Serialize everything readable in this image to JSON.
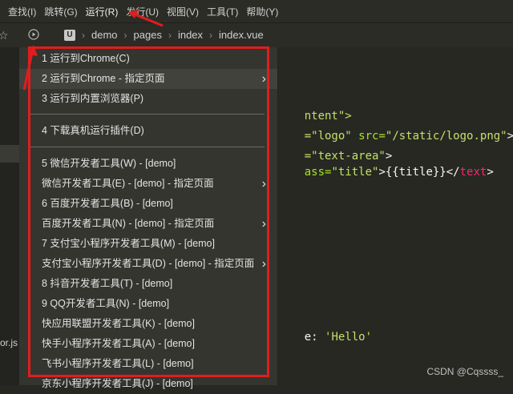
{
  "menubar": {
    "items": [
      "查找(I)",
      "跳转(G)",
      "运行(R)",
      "发行(U)",
      "视图(V)",
      "工具(T)",
      "帮助(Y)"
    ]
  },
  "toolbar": {
    "breadcrumb": [
      "demo",
      "pages",
      "index",
      "index.vue"
    ],
    "u_label": "U"
  },
  "sidebar": {
    "file_label": "or.js"
  },
  "run_menu": {
    "items": [
      {
        "label": "1 运行到Chrome(C)",
        "has_submenu": false
      },
      {
        "label": "2 运行到Chrome - 指定页面",
        "has_submenu": true
      },
      {
        "label": "3 运行到内置浏览器(P)",
        "has_submenu": false
      },
      {
        "label": "4 下载真机运行插件(D)",
        "has_submenu": false
      },
      {
        "label": "5 微信开发者工具(W) - [demo]",
        "has_submenu": false
      },
      {
        "label": "微信开发者工具(E) - [demo] - 指定页面",
        "has_submenu": true
      },
      {
        "label": "6 百度开发者工具(B) - [demo]",
        "has_submenu": false
      },
      {
        "label": "百度开发者工具(N) - [demo] - 指定页面",
        "has_submenu": true
      },
      {
        "label": "7 支付宝小程序开发者工具(M) - [demo]",
        "has_submenu": false
      },
      {
        "label": "支付宝小程序开发者工具(D) - [demo] - 指定页面",
        "has_submenu": true
      },
      {
        "label": "8 抖音开发者工具(T) - [demo]",
        "has_submenu": false
      },
      {
        "label": "9 QQ开发者工具(N) - [demo]",
        "has_submenu": false
      },
      {
        "label": "快应用联盟开发者工具(K) - [demo]",
        "has_submenu": false
      },
      {
        "label": "快手小程序开发者工具(A) - [demo]",
        "has_submenu": false
      },
      {
        "label": "飞书小程序开发者工具(L) - [demo]",
        "has_submenu": false
      },
      {
        "label": "京东小程序开发者工具(J) - [demo]",
        "has_submenu": false
      }
    ]
  },
  "editor": {
    "line1": "ntent\">",
    "line2_a": "=\"logo\"",
    "line2_b": " src=",
    "line2_c": "\"/static/logo.png\"",
    "line2_d": "></",
    "line3_a": "=\"text-area\"",
    "line3_b": ">",
    "line4_a": "ass=",
    "line4_b": "\"title\"",
    "line4_c": ">{{title}}</",
    "line4_d": "text",
    "line4_e": ">",
    "line5_a": "e: ",
    "line5_b": "'Hello'"
  },
  "watermark": "CSDN @Cqssss_",
  "colors": {
    "highlight_frame": "#e11d1d",
    "menu_bg": "#34352f",
    "editor_bg": "#272822"
  }
}
